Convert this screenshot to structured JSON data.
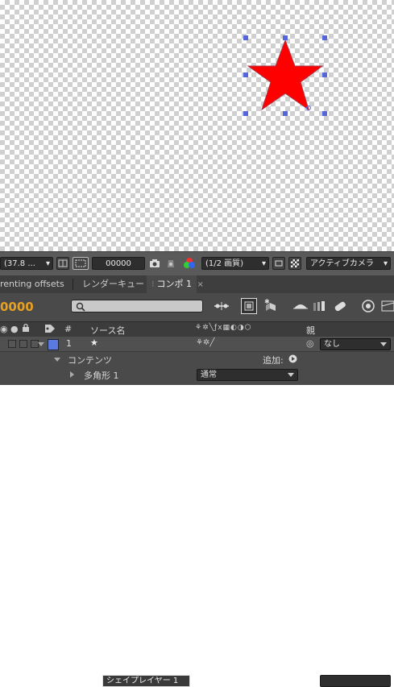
{
  "viewer_toolbar": {
    "zoom": "(37.8 ...",
    "timecode_field": "00000",
    "resolution": "(1/2 画質)",
    "camera": "アクティブカメラ"
  },
  "tabs": [
    {
      "label": "renting offsets",
      "active": false
    },
    {
      "label": "レンダーキュー",
      "active": false
    },
    {
      "label": "コンポ 1",
      "active": true
    }
  ],
  "timeline": {
    "current_time": "0000",
    "search_placeholder": "",
    "columns": {
      "number": "#",
      "source_name": "ソース名",
      "parent": "親"
    },
    "layer": {
      "number": "1",
      "name": "シェイプレイヤー 1",
      "label_color": "#5b7ae0",
      "parent": "なし"
    },
    "contents_row": {
      "label": "コンテンツ",
      "add_label": "追加:"
    },
    "polygon_row": {
      "label": "多角形 1",
      "blend_mode": "通常"
    }
  },
  "colors": {
    "star_fill": "#ff0000",
    "handles": "#5566dd",
    "timecode": "#e8a021"
  }
}
